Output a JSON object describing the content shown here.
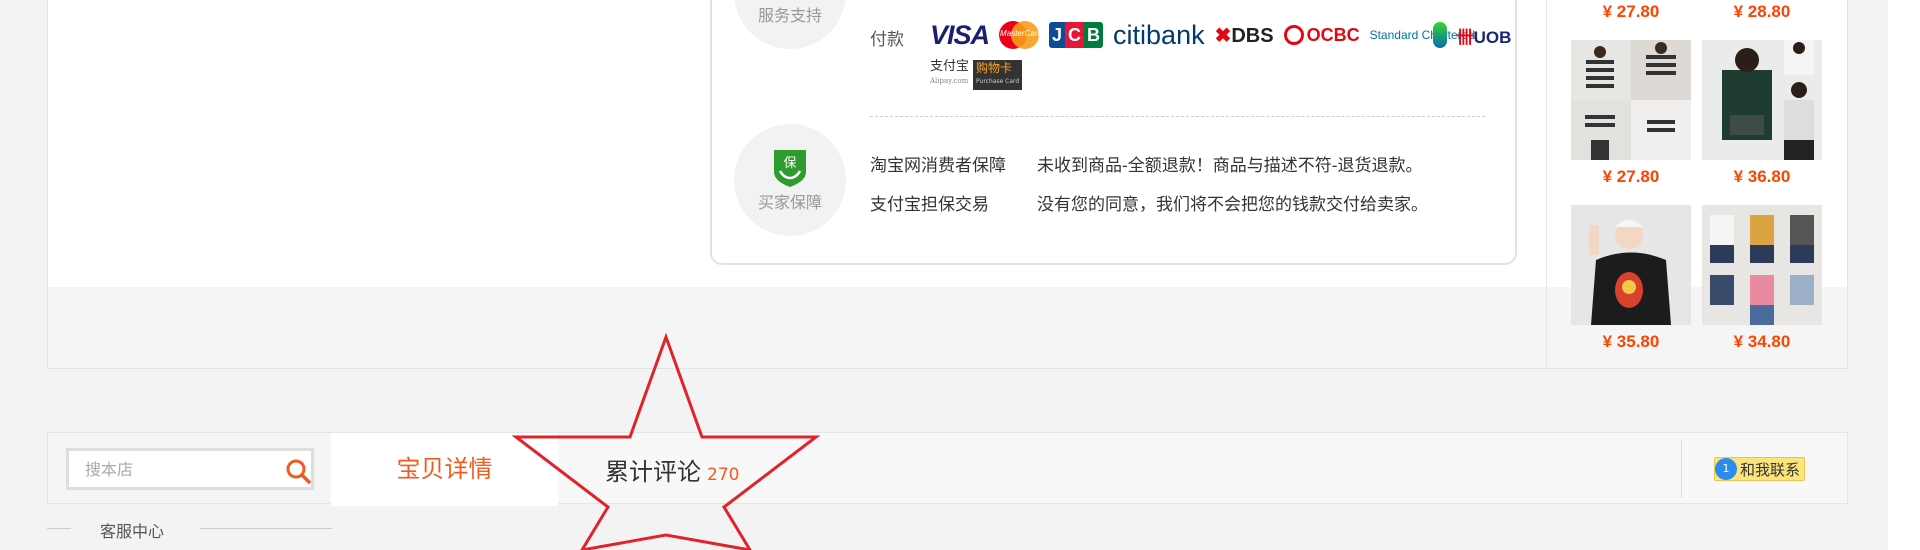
{
  "service": {
    "service_label": "服务支持",
    "pay_label": "付款",
    "pay_logos": {
      "visa": "VISA",
      "mastercard": "MasterCard",
      "jcb": "JCB",
      "citi": "citibank",
      "dbs": "DBS",
      "ocbc": "OCBC",
      "standard_chartered": "Standard Chartered",
      "uob": "UOB",
      "alipay": "支付宝",
      "alipay_sub": "Alipay.com",
      "purchase_card": "购物卡",
      "purchase_card_sub": "Purchase Card"
    },
    "buyer_label": "买家保障",
    "shield_char": "保",
    "guarantees": [
      {
        "name": "淘宝网消费者保障",
        "desc": "未收到商品-全额退款！商品与描述不符-退货退款。"
      },
      {
        "name": "支付宝担保交易",
        "desc": "没有您的同意，我们将不会把您的钱款交付给卖家。"
      }
    ]
  },
  "sidebar_products": [
    {
      "price": "¥ 27.80"
    },
    {
      "price": "¥ 28.80"
    },
    {
      "price": "¥ 27.80"
    },
    {
      "price": "¥ 36.80"
    },
    {
      "price": "¥ 35.80"
    },
    {
      "price": "¥ 34.80"
    }
  ],
  "tabs": {
    "search_placeholder": "搜本店",
    "detail": "宝贝详情",
    "reviews": "累计评论",
    "review_count": "270",
    "contact": "和我联系",
    "contact_badge": "1"
  },
  "customer_service": "客服中心",
  "colors": {
    "accent": "#f25a1e",
    "price": "#ff4400",
    "star": "#e0232a"
  }
}
